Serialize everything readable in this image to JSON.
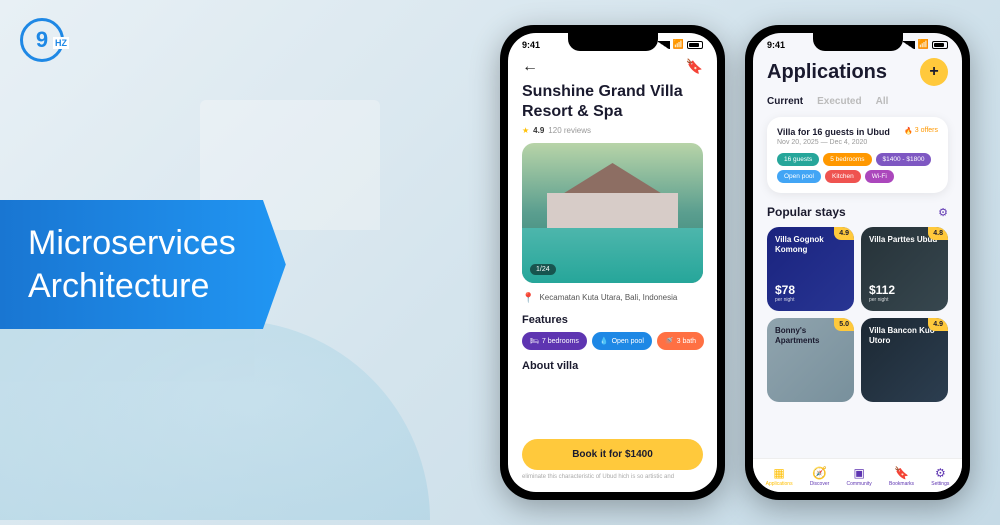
{
  "logo": {
    "text": "9",
    "suffix": "HZ"
  },
  "banner": {
    "line1": "Microservices",
    "line2": "Architecture"
  },
  "statusbar": {
    "time": "9:41"
  },
  "phone1": {
    "title": "Sunshine Grand Villa Resort & Spa",
    "rating": "4.9",
    "reviews": "120 reviews",
    "image_counter": "1/24",
    "location": "Kecamatan Kuta Utara, Bali, Indonesia",
    "features_title": "Features",
    "features": [
      {
        "icon": "🛏",
        "label": "7 bedrooms"
      },
      {
        "icon": "💧",
        "label": "Open pool"
      },
      {
        "icon": "🚿",
        "label": "3 bath"
      }
    ],
    "about_title": "About villa",
    "about_text": "eliminate this characteristic of Ubud hich is so artistic and",
    "book_button": "Book it for $1400"
  },
  "phone2": {
    "title": "Applications",
    "tabs": [
      "Current",
      "Executed",
      "All"
    ],
    "card": {
      "title": "Villa for 16 guests in Ubud",
      "offers": "3 offers",
      "dates": "Nov 20, 2025 — Dec 4, 2020",
      "tags": [
        "16 guests",
        "5 bedrooms",
        "$1400 - $1800",
        "Open pool",
        "Kitchen",
        "Wi-Fi"
      ]
    },
    "popular_title": "Popular stays",
    "stays": [
      {
        "name": "Villa Gognok Komong",
        "price": "$78",
        "sub": "per night",
        "rating": "4.9"
      },
      {
        "name": "Villa Parttes Ubud",
        "price": "$112",
        "sub": "per night",
        "rating": "4.8"
      },
      {
        "name": "Bonny's Apartments",
        "price": "",
        "sub": "",
        "rating": "5.0"
      },
      {
        "name": "Villa Bancon Kuo Utoro",
        "price": "",
        "sub": "",
        "rating": "4.9"
      }
    ],
    "nav": [
      "Applications",
      "Discover",
      "Community",
      "Bookmarks",
      "Settings"
    ]
  }
}
